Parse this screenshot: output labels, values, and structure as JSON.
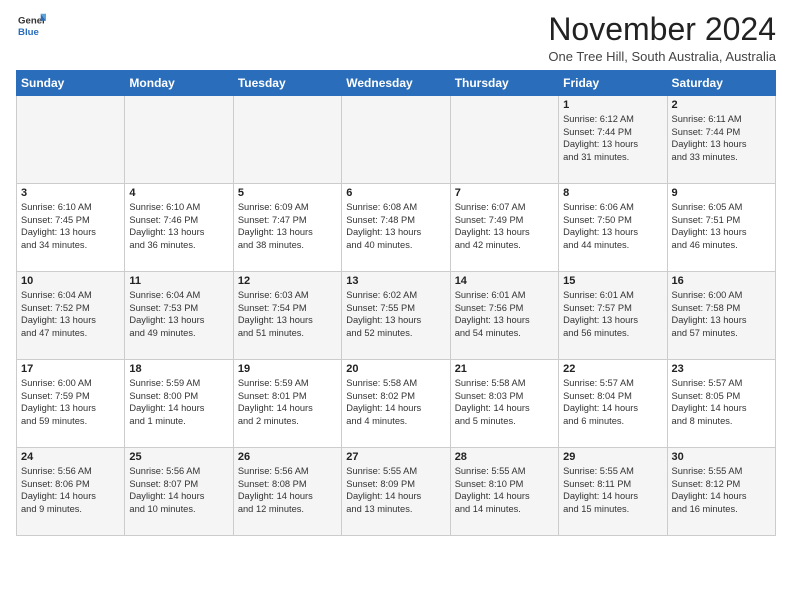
{
  "logo": {
    "general": "General",
    "blue": "Blue"
  },
  "header": {
    "month": "November 2024",
    "location": "One Tree Hill, South Australia, Australia"
  },
  "weekdays": [
    "Sunday",
    "Monday",
    "Tuesday",
    "Wednesday",
    "Thursday",
    "Friday",
    "Saturday"
  ],
  "weeks": [
    [
      {
        "day": "",
        "info": ""
      },
      {
        "day": "",
        "info": ""
      },
      {
        "day": "",
        "info": ""
      },
      {
        "day": "",
        "info": ""
      },
      {
        "day": "",
        "info": ""
      },
      {
        "day": "1",
        "info": "Sunrise: 6:12 AM\nSunset: 7:44 PM\nDaylight: 13 hours\nand 31 minutes."
      },
      {
        "day": "2",
        "info": "Sunrise: 6:11 AM\nSunset: 7:44 PM\nDaylight: 13 hours\nand 33 minutes."
      }
    ],
    [
      {
        "day": "3",
        "info": "Sunrise: 6:10 AM\nSunset: 7:45 PM\nDaylight: 13 hours\nand 34 minutes."
      },
      {
        "day": "4",
        "info": "Sunrise: 6:10 AM\nSunset: 7:46 PM\nDaylight: 13 hours\nand 36 minutes."
      },
      {
        "day": "5",
        "info": "Sunrise: 6:09 AM\nSunset: 7:47 PM\nDaylight: 13 hours\nand 38 minutes."
      },
      {
        "day": "6",
        "info": "Sunrise: 6:08 AM\nSunset: 7:48 PM\nDaylight: 13 hours\nand 40 minutes."
      },
      {
        "day": "7",
        "info": "Sunrise: 6:07 AM\nSunset: 7:49 PM\nDaylight: 13 hours\nand 42 minutes."
      },
      {
        "day": "8",
        "info": "Sunrise: 6:06 AM\nSunset: 7:50 PM\nDaylight: 13 hours\nand 44 minutes."
      },
      {
        "day": "9",
        "info": "Sunrise: 6:05 AM\nSunset: 7:51 PM\nDaylight: 13 hours\nand 46 minutes."
      }
    ],
    [
      {
        "day": "10",
        "info": "Sunrise: 6:04 AM\nSunset: 7:52 PM\nDaylight: 13 hours\nand 47 minutes."
      },
      {
        "day": "11",
        "info": "Sunrise: 6:04 AM\nSunset: 7:53 PM\nDaylight: 13 hours\nand 49 minutes."
      },
      {
        "day": "12",
        "info": "Sunrise: 6:03 AM\nSunset: 7:54 PM\nDaylight: 13 hours\nand 51 minutes."
      },
      {
        "day": "13",
        "info": "Sunrise: 6:02 AM\nSunset: 7:55 PM\nDaylight: 13 hours\nand 52 minutes."
      },
      {
        "day": "14",
        "info": "Sunrise: 6:01 AM\nSunset: 7:56 PM\nDaylight: 13 hours\nand 54 minutes."
      },
      {
        "day": "15",
        "info": "Sunrise: 6:01 AM\nSunset: 7:57 PM\nDaylight: 13 hours\nand 56 minutes."
      },
      {
        "day": "16",
        "info": "Sunrise: 6:00 AM\nSunset: 7:58 PM\nDaylight: 13 hours\nand 57 minutes."
      }
    ],
    [
      {
        "day": "17",
        "info": "Sunrise: 6:00 AM\nSunset: 7:59 PM\nDaylight: 13 hours\nand 59 minutes."
      },
      {
        "day": "18",
        "info": "Sunrise: 5:59 AM\nSunset: 8:00 PM\nDaylight: 14 hours\nand 1 minute."
      },
      {
        "day": "19",
        "info": "Sunrise: 5:59 AM\nSunset: 8:01 PM\nDaylight: 14 hours\nand 2 minutes."
      },
      {
        "day": "20",
        "info": "Sunrise: 5:58 AM\nSunset: 8:02 PM\nDaylight: 14 hours\nand 4 minutes."
      },
      {
        "day": "21",
        "info": "Sunrise: 5:58 AM\nSunset: 8:03 PM\nDaylight: 14 hours\nand 5 minutes."
      },
      {
        "day": "22",
        "info": "Sunrise: 5:57 AM\nSunset: 8:04 PM\nDaylight: 14 hours\nand 6 minutes."
      },
      {
        "day": "23",
        "info": "Sunrise: 5:57 AM\nSunset: 8:05 PM\nDaylight: 14 hours\nand 8 minutes."
      }
    ],
    [
      {
        "day": "24",
        "info": "Sunrise: 5:56 AM\nSunset: 8:06 PM\nDaylight: 14 hours\nand 9 minutes."
      },
      {
        "day": "25",
        "info": "Sunrise: 5:56 AM\nSunset: 8:07 PM\nDaylight: 14 hours\nand 10 minutes."
      },
      {
        "day": "26",
        "info": "Sunrise: 5:56 AM\nSunset: 8:08 PM\nDaylight: 14 hours\nand 12 minutes."
      },
      {
        "day": "27",
        "info": "Sunrise: 5:55 AM\nSunset: 8:09 PM\nDaylight: 14 hours\nand 13 minutes."
      },
      {
        "day": "28",
        "info": "Sunrise: 5:55 AM\nSunset: 8:10 PM\nDaylight: 14 hours\nand 14 minutes."
      },
      {
        "day": "29",
        "info": "Sunrise: 5:55 AM\nSunset: 8:11 PM\nDaylight: 14 hours\nand 15 minutes."
      },
      {
        "day": "30",
        "info": "Sunrise: 5:55 AM\nSunset: 8:12 PM\nDaylight: 14 hours\nand 16 minutes."
      }
    ]
  ]
}
